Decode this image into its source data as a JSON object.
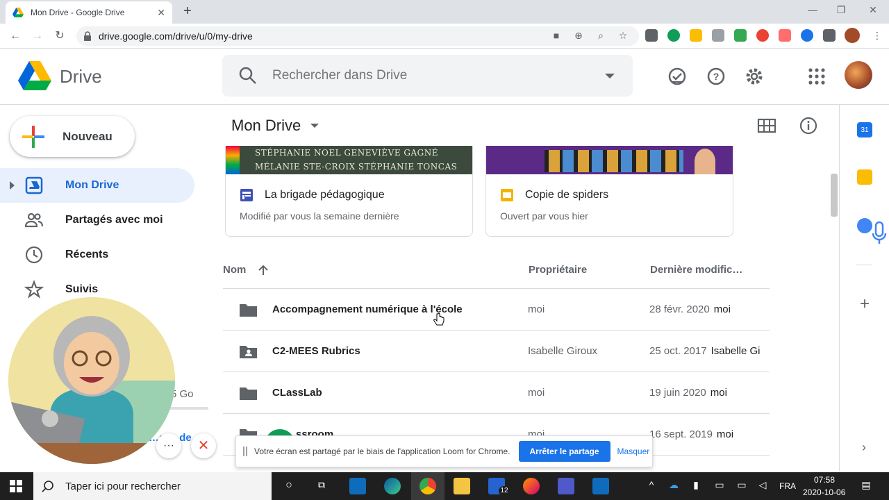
{
  "browser": {
    "tab_title": "Mon Drive - Google Drive",
    "url": "drive.google.com/drive/u/0/my-drive"
  },
  "drive": {
    "app_name": "Drive",
    "search_placeholder": "Rechercher dans Drive",
    "new_label": "Nouveau",
    "nav": [
      {
        "label": "Mon Drive",
        "icon": "drive-icon",
        "active": true
      },
      {
        "label": "Partagés avec moi",
        "icon": "people-icon"
      },
      {
        "label": "Récents",
        "icon": "clock-icon"
      },
      {
        "label": "Suivis",
        "icon": "star-icon"
      }
    ],
    "storage_text": "5 Go",
    "storage_fraction": 0.3,
    "buy_text": "…ace de",
    "page_title": "Mon Drive",
    "quick_access": [
      {
        "title": "La brigade pédagogique",
        "subtitle": "Modifié par vous la semaine dernière",
        "icon": "google-forms-icon",
        "thumb_text": "STÉPHANIE NOEL  GENEVIÈVE GAGNÉ  MÉLANIE STE-CROIX  STÉPHANIE TONCAS"
      },
      {
        "title": "Copie de spiders",
        "subtitle": "Ouvert par vous hier",
        "icon": "google-slides-icon"
      }
    ],
    "columns": {
      "name": "Nom",
      "owner": "Propriétaire",
      "modified": "Dernière modific…"
    },
    "files": [
      {
        "name": "Accompagnement numérique à l'école",
        "owner": "moi",
        "date": "28 févr. 2020",
        "by": "moi",
        "type": "folder"
      },
      {
        "name": "C2-MEES Rubrics",
        "owner": "Isabelle Giroux",
        "date": "25 oct. 2017",
        "by": "Isabelle Gi",
        "type": "shared-folder"
      },
      {
        "name": "CLassLab",
        "owner": "moi",
        "date": "19 juin 2020",
        "by": "moi",
        "type": "folder"
      },
      {
        "name": "…ssroom",
        "owner": "moi",
        "date": "16 sept. 2019",
        "by": "moi",
        "type": "folder"
      }
    ]
  },
  "sharebar": {
    "text": "Votre écran est partagé par le biais de l'application Loom for Chrome.",
    "stop_label": "Arrêter le partage",
    "hide_label": "Masquer"
  },
  "taskbar": {
    "search_placeholder": "Taper ici pour rechercher",
    "language": "FRA",
    "time": "07:58",
    "date": "2020-10-06",
    "todo_badge": "12"
  },
  "colors": {
    "accent": "#1a73e8",
    "active_nav_bg": "#e8f0fe",
    "taskbar": "#1f1f1f"
  }
}
